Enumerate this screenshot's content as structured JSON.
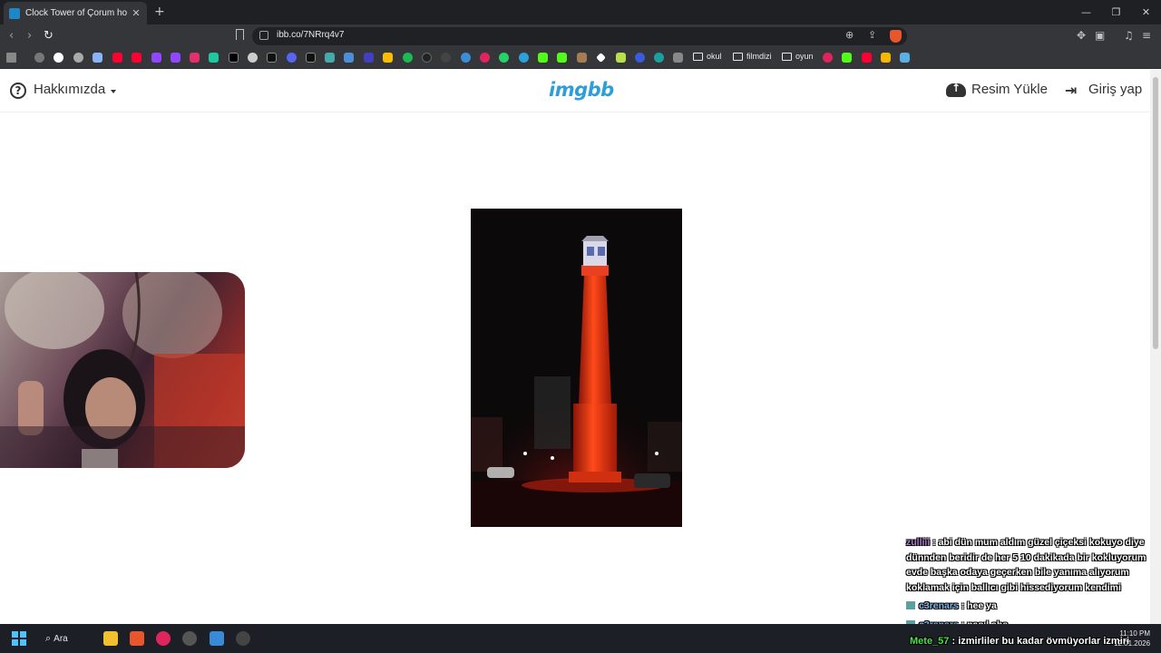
{
  "browser": {
    "tab_title": "Clock Tower of Çorum hosted at",
    "tab_favicon_text": "ibb",
    "url": "ibb.co/7NRrq4v7",
    "bookmark_folders": [
      "okul",
      "filmdizi",
      "oyun"
    ]
  },
  "header": {
    "about_label": "Hakkımızda",
    "logo_text": "imgbb",
    "upload_label": "Resim Yükle",
    "login_label": "Giriş yap",
    "logo_color": "#2d9ed8"
  },
  "main_image": {
    "subject": "Clock Tower of Çorum at night, lit red"
  },
  "chat": {
    "messages": [
      {
        "user": "zulliii",
        "text": ": abi dün mum aldım güzel çiçeksi kokuyo diye dünnden beridir de her 5 10 dakikada bir kokluyorum evde başka odaya geçerken bile yanıma alıyorum koklamak için ballıcı gibi hissediyorum kendimi"
      },
      {
        "user": "c3renars",
        "text": ": hee ya"
      },
      {
        "user": "c3renars",
        "text": ": nasıl abe"
      }
    ],
    "latest": {
      "user": "Mete_57",
      "text": ": izmirliler bu kadar övmüyorlar izmiri"
    }
  },
  "taskbar": {
    "search_label": "Ara",
    "time": "11:10 PM",
    "date": "12.01.2026"
  }
}
